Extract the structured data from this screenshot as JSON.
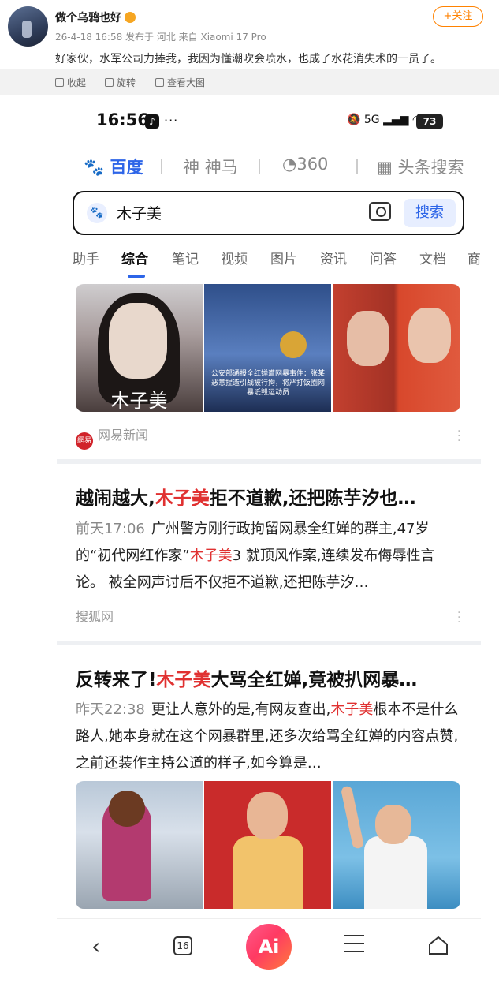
{
  "post": {
    "username": "做个乌鸦也好",
    "meta": "26-4-18 16:58  发布于 河北  来自 Xiaomi 17 Pro",
    "follow_label": "+关注",
    "text": "好家伙，水军公司力捧我，我因为懂潮吹会喷水，也成了水花消失术的一员了。",
    "actions": [
      "收起",
      "旋转",
      "查看大图"
    ]
  },
  "status_bar": {
    "time": "16:56",
    "app_icon": "tiktok-icon",
    "dots": "···",
    "icons": "5G",
    "battery": "73"
  },
  "engines": [
    "百度",
    "神马",
    "360",
    "头条搜索"
  ],
  "search": {
    "value": "木子美",
    "button": "搜索"
  },
  "tabs": [
    "助手",
    "综合",
    "笔记",
    "视频",
    "图片",
    "资讯",
    "问答",
    "文档",
    "商"
  ],
  "result1": {
    "image_caption": "木子美",
    "image2_text": "公安部通报全红婵遭网暴事件：张某恶意捏造引战被行拘，将严打饭圈网暴诋毁运动员",
    "source": "网易新闻",
    "source_logo": "網易"
  },
  "result2": {
    "title_pre": "越闹越大,",
    "title_hl": "木子美",
    "title_post": "拒不道歉,还把陈芋汐也…",
    "date": "前天17:06",
    "snippet_pre": "广州警方刚行政拘留网暴全红婵的群主,47岁的“初代网红作家”",
    "snippet_hl": "木子美",
    "snippet_post": "3 就顶风作案,连续发布侮辱性言论。 被全网声讨后不仅拒不道歉,还把陈芋汐…",
    "source": "搜狐网"
  },
  "result3": {
    "title_pre": "反转来了!",
    "title_hl": "木子美",
    "title_post": "大骂全红婵,竟被扒网暴…",
    "date": "昨天22:38",
    "snippet_pre": "更让人意外的是,有网友查出,",
    "snippet_hl": "木子美",
    "snippet_post": "根本不是什么路人,她本身就在这个网暴群里,还多次给骂全红婵的内容点赞,之前还装作主持公道的样子,如今算是…"
  },
  "navbar": {
    "tabs_count": "16",
    "ai_label": "Ai"
  }
}
